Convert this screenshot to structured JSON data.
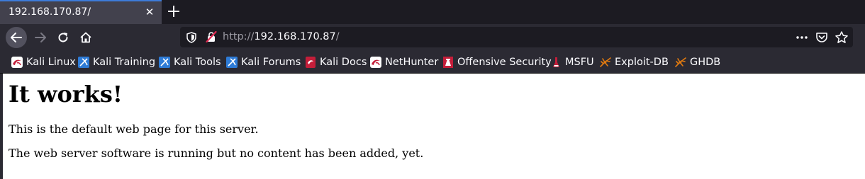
{
  "tab": {
    "title": "192.168.170.87/",
    "close_glyph": "✕"
  },
  "urlbar": {
    "protocol": "http://",
    "host": "192.168.170.87",
    "path": "/"
  },
  "bookmarks": [
    {
      "label": "Kali Linux",
      "icon": "kali-dragon-icon"
    },
    {
      "label": "Kali Training",
      "icon": "kali-training-icon"
    },
    {
      "label": "Kali Tools",
      "icon": "kali-tools-icon"
    },
    {
      "label": "Kali Forums",
      "icon": "kali-forums-icon"
    },
    {
      "label": "Kali Docs",
      "icon": "kali-docs-icon"
    },
    {
      "label": "NetHunter",
      "icon": "nethunter-icon"
    },
    {
      "label": "Offensive Security",
      "icon": "offsec-icon"
    },
    {
      "label": "MSFU",
      "icon": "msfu-icon"
    },
    {
      "label": "Exploit-DB",
      "icon": "exploit-db-icon"
    },
    {
      "label": "GHDB",
      "icon": "ghdb-icon"
    }
  ],
  "page": {
    "heading": "It works!",
    "paragraphs": [
      "This is the default web page for this server.",
      "The web server software is running but no content has been added, yet."
    ]
  },
  "colors": {
    "accent": "#3d7bd9",
    "toolbar": "#2b2a33",
    "tabstrip": "#1c1b22"
  }
}
